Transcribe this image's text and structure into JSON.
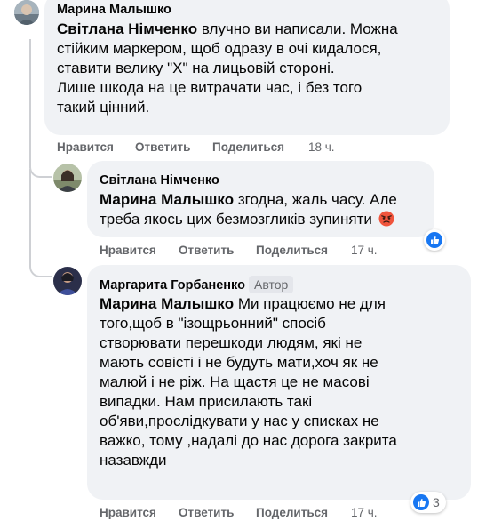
{
  "comments": [
    {
      "author": "Марина Малышко",
      "mention": "Світлана Німченко",
      "text_lines": [
        " влучно ви написали. Можна",
        "стійким маркером, щоб одразу в очі кидалося,",
        "ставити велику \"Х\" на лицьовій стороні.",
        "Лише шкода на це витрачати час, і без того",
        "такий цінний."
      ],
      "actions": {
        "like": "Нравится",
        "reply": "Ответить",
        "share": "Поделиться",
        "time": "18 ч."
      }
    },
    {
      "author": "Світлана Німченко",
      "mention": "Марина Малышко",
      "text_lines": [
        " згодна, жаль часу. Але",
        "треба якось цих безмозгликів зупиняти"
      ],
      "emoji": "angry-face-icon",
      "actions": {
        "like": "Нравится",
        "reply": "Ответить",
        "share": "Поделиться",
        "time": "17 ч."
      },
      "reactions": {
        "icon": "like-icon"
      }
    },
    {
      "author": "Маргарита Горбаненко",
      "author_badge": "Автор",
      "mention": "Марина Малышко",
      "text_lines": [
        " Ми працюємо не для",
        "того,щоб в \"ізощрьонний\" спосіб",
        "створювати перешкоди людям, які не",
        "мають совісті і не будуть мати,хоч як не",
        "малюй і не ріж. На щастя це не масові",
        "випадки. Нам присилають такі",
        "об'яви,прослідкувати у нас у списках не",
        "важко, тому ,надалі до нас дорога закрита",
        "назавжди"
      ],
      "actions": {
        "like": "Нравится",
        "reply": "Ответить",
        "share": "Поделиться",
        "time": "17 ч."
      },
      "reactions": {
        "icon": "like-icon",
        "count": "3"
      }
    }
  ],
  "colors": {
    "bubble": "#f0f2f5",
    "meta": "#65676b",
    "like_blue": "#1877f2",
    "thread_line": "#ced0d4"
  }
}
